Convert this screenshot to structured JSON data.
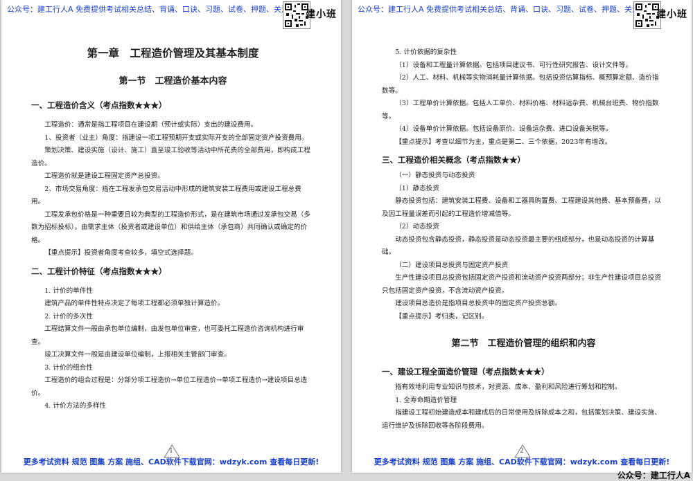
{
  "header": {
    "text": "公众号：建工行人A 免费提供考试相关总结、背诵、口诀、习题、试卷、押题、关注即",
    "brand": "建小班"
  },
  "footer": {
    "text": "更多考试资料 规范 图集 方案 施组、CAD软件下载官网：wdzyk.com 查看每日更新!"
  },
  "corner_text": "公众号：建工行人A",
  "page1": {
    "number": "1",
    "chapter_title": "第一章　工程造价管理及其基本制度",
    "section_title": "第一节　工程造价基本内容",
    "s1_heading": "一、工程造价含义（考点指数★★★）",
    "s1_p1": "工程造价：通常是指工程项目在建设期（预计或实际）支出的建设费用。",
    "s1_p2": "1、投资者（业主）角度：指建设一项工程预期开支或实际开支的全部固定资产投资费用。",
    "s1_p3": "策划决策、建设实施（设计、施工）直至竣工验收等活动中所花费的全部费用，即构成工程造价。",
    "s1_p4": "工程造价就是建设工程固定资产总投资。",
    "s1_p5": "2、市场交易角度：指在工程发承包交易活动中形成的建筑安装工程费用或建设工程总费用。",
    "s1_p6": "工程发承包价格是一种重要且较为典型的工程造价形式，是在建筑市场通过发承包交易（多数为招标投标），由需求主体（投资者或建设单位）和供给主体（承包商）共同确认或确定的价格。",
    "s1_tip": "【重点提示】投资者角度考查较多，填空式选择题。",
    "s2_heading": "二、工程计价特征（考点指数★★★）",
    "s2_i1": "1. 计价的单件性",
    "s2_p1": "建筑产品的单件性特点决定了每项工程都必须单独计算造价。",
    "s2_i2": "2. 计价的多次性",
    "s2_p2": "工程结算文件一般由承包单位编制，由发包单位审查，也可委托工程造价咨询机构进行审查。",
    "s2_p3": "竣工决算文件一般是由建设单位编制，上报相关主管部门审查。",
    "s2_i3": "3. 计价的组合性",
    "s2_p4": "工程造价的组合过程是：分部分项工程造价→单位工程造价→单项工程造价→建设项目总造价。",
    "s2_i4": "4. 计价方法的多样性"
  },
  "page2": {
    "number": "2",
    "i5": "5. 计价依据的复杂性",
    "b1": "（1）设备和工程量计算依据。包括项目建议书、可行性研究报告、设计文件等。",
    "b2": "（2）人工、材料、机械等实物消耗量计算依据。包括投资估算指标、概预算定额、造价指数等。",
    "b3": "（3）工程单价计算依据。包括人工单价、材料价格、材料运杂费、机械台班费、物价指数等。",
    "b4": "（4）设备单价计算依据。包括设备原价、设备运杂费、进口设备关税等。",
    "tip1": "【重点提示】考查以细节为主，重点是第二、三个依据，2023年有增改。",
    "s3_heading": "三、工程造价相关概念（考点指数★★）",
    "s3_a": "（一）静态投资与动态投资",
    "s3_a1": "（1）静态投资",
    "s3_a1p": "静态投资包括：建筑安装工程费、设备和工器具购置费、工程建设其他费、基本预备费，以及因工程量误差而引起的工程造价增减值等。",
    "s3_a2": "（2）动态投资",
    "s3_a2p": "动态投资包含静态投资，静态投资是动态投资最主要的组成部分，也是动态投资的计算基础。",
    "s3_b": "（二）建设项目总投资与固定资产投资",
    "s3_bp1": "生产性建设项目总投资包括固定资产投资和流动资产投资两部分；非生产性建设项目总投资只包括固定资产投资，不含流动资产投资。",
    "s3_bp2": "建设项目总造价是指项目总投资中的固定资产投资总额。",
    "tip2": "【重点提示】考归类，记区别。",
    "section2_title": "第二节　工程造价管理的组织和内容",
    "s4_heading": "一、建设工程全面造价管理（考点指数★★★）",
    "s4_p1": "指有效地利用专业知识与技术，对资源、成本、盈利和风险进行筹划和控制。",
    "s4_i1": "1. 全寿命期造价管理",
    "s4_p2": "指建设工程初始建造成本和建成后的日常使用及拆除成本之和，包括策划决策、建设实施、运行维护及拆除回收等各阶段费用。"
  }
}
